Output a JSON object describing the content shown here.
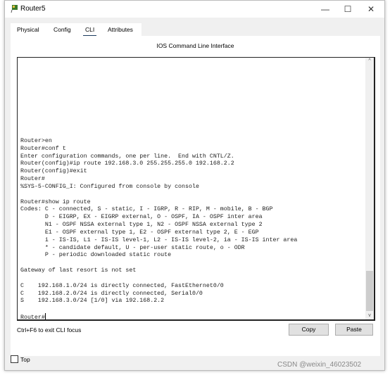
{
  "window": {
    "title": "Router5",
    "minimize": "—",
    "maximize": "☐",
    "close": "✕",
    "icon": "router-icon"
  },
  "tabs": [
    {
      "label": "Physical"
    },
    {
      "label": "Config"
    },
    {
      "label": "CLI",
      "active": true
    },
    {
      "label": "Attributes"
    }
  ],
  "cli": {
    "header": "IOS Command Line Interface",
    "lines": [
      "Router>en",
      "Router#conf t",
      "Enter configuration commands, one per line.  End with CNTL/Z.",
      "Router(config)#ip route 192.168.3.0 255.255.255.0 192.168.2.2",
      "Router(config)#exit",
      "Router#",
      "%SYS-5-CONFIG_I: Configured from console by console",
      "",
      "Router#show ip route",
      "Codes: C - connected, S - static, I - IGRP, R - RIP, M - mobile, B - BGP",
      "       D - EIGRP, EX - EIGRP external, O - OSPF, IA - OSPF inter area",
      "       N1 - OSPF NSSA external type 1, N2 - OSPF NSSA external type 2",
      "       E1 - OSPF external type 1, E2 - OSPF external type 2, E - EGP",
      "       i - IS-IS, L1 - IS-IS level-1, L2 - IS-IS level-2, ia - IS-IS inter area",
      "       * - candidate default, U - per-user static route, o - ODR",
      "       P - periodic downloaded static route",
      "",
      "Gateway of last resort is not set",
      "",
      "C    192.168.1.0/24 is directly connected, FastEthernet0/0",
      "C    192.168.2.0/24 is directly connected, Serial0/0",
      "S    192.168.3.0/24 [1/0] via 192.168.2.2",
      ""
    ],
    "prompt": "Router#",
    "hint": "Ctrl+F6 to exit CLI focus",
    "copy": "Copy",
    "paste": "Paste"
  },
  "top_checkbox": {
    "label": "Top",
    "checked": false
  },
  "watermark": "CSDN @weixin_46023502"
}
